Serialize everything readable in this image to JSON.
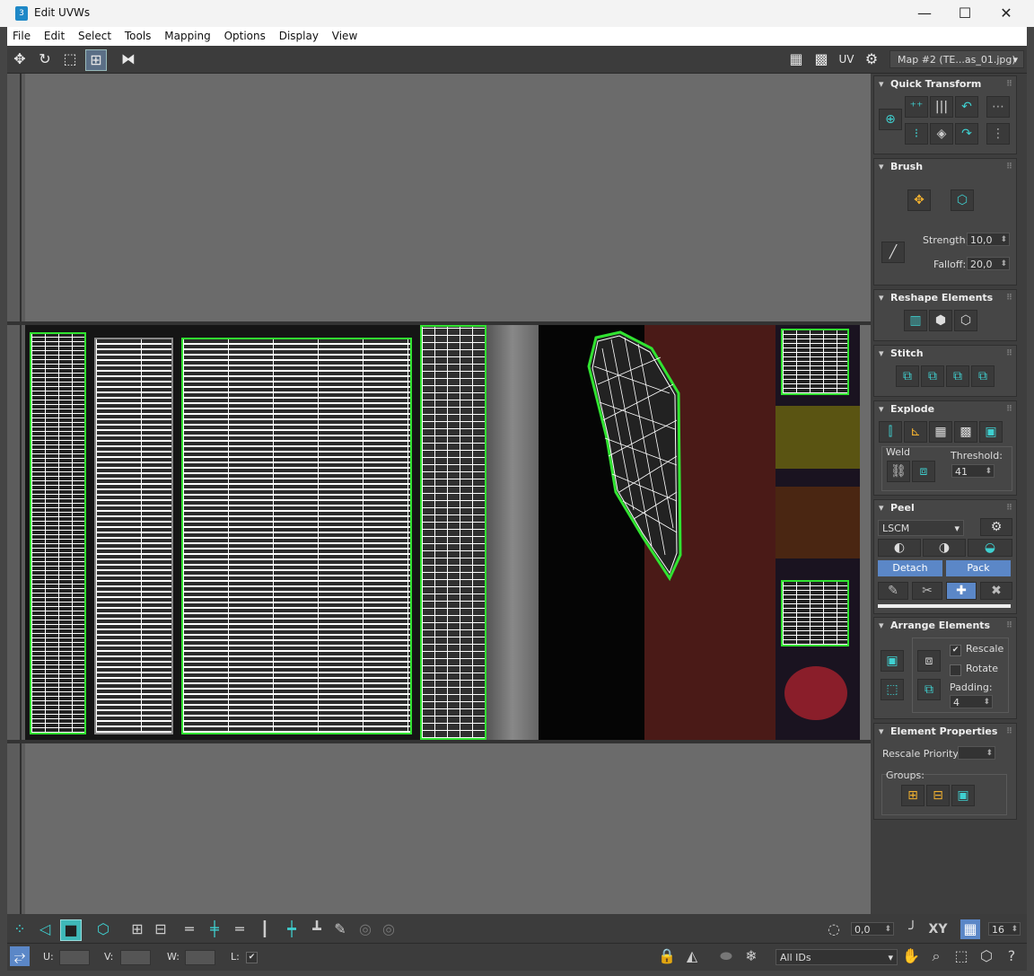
{
  "window": {
    "title": "Edit UVWs",
    "app_icon": "3",
    "minimize": "—",
    "maximize": "☐",
    "close": "✕"
  },
  "menu": [
    "File",
    "Edit",
    "Select",
    "Tools",
    "Mapping",
    "Options",
    "Display",
    "View"
  ],
  "toolbar": {
    "uv_label": "UV",
    "map_dropdown": "Map #2 (TE...as_01.jpg)"
  },
  "panel": {
    "quick_transform": {
      "title": "Quick Transform"
    },
    "brush": {
      "title": "Brush",
      "strength_label": "Strength:",
      "strength_value": "10,0",
      "falloff_label": "Falloff:",
      "falloff_value": "20,0"
    },
    "reshape": {
      "title": "Reshape Elements"
    },
    "stitch": {
      "title": "Stitch"
    },
    "explode": {
      "title": "Explode",
      "weld_label": "Weld",
      "threshold_label": "Threshold:",
      "threshold_value": "41"
    },
    "peel": {
      "title": "Peel",
      "mode": "LSCM",
      "detach_label": "Detach",
      "pack_label": "Pack"
    },
    "arrange": {
      "title": "Arrange Elements",
      "rescale_label": "Rescale",
      "rotate_label": "Rotate",
      "padding_label": "Padding:",
      "padding_value": "4"
    },
    "element_props": {
      "title": "Element Properties",
      "rescale_priority_label": "Rescale Priority:",
      "groups_label": "Groups:"
    }
  },
  "bottom": {
    "spin_value": "0,0",
    "xy_label": "XY",
    "grid_value": "16",
    "u_label": "U:",
    "v_label": "V:",
    "w_label": "W:",
    "l_label": "L:",
    "ids_dropdown": "All IDs"
  }
}
